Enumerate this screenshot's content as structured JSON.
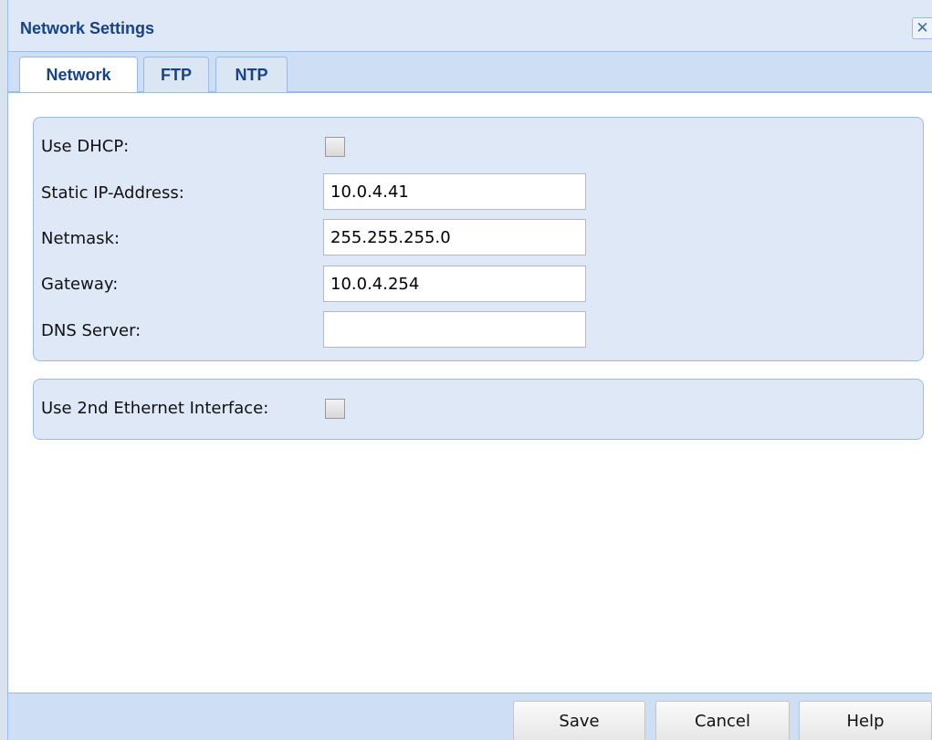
{
  "window": {
    "title": "Network Settings",
    "close_symbol": "✕",
    "close_icon": "close-icon"
  },
  "tabs": [
    {
      "label": "Network",
      "active": true
    },
    {
      "label": "FTP",
      "active": false
    },
    {
      "label": "NTP",
      "active": false
    }
  ],
  "network": {
    "use_dhcp": {
      "label": "Use DHCP:",
      "checked": false
    },
    "static_ip": {
      "label": "Static IP-Address:",
      "value": "10.0.4.41"
    },
    "netmask": {
      "label": "Netmask:",
      "value": "255.255.255.0"
    },
    "gateway": {
      "label": "Gateway:",
      "value": "10.0.4.254"
    },
    "dns_server": {
      "label": "DNS Server:",
      "value": ""
    },
    "second_ethernet": {
      "label": "Use 2nd Ethernet Interface:",
      "checked": false
    }
  },
  "footer": {
    "save_label": "Save",
    "cancel_label": "Cancel",
    "help_label": "Help"
  },
  "colors": {
    "title_text": "#15428b",
    "panel_background": "#dfe8f6",
    "border": "#99bbe8",
    "tab_strip": "#cedff5"
  }
}
